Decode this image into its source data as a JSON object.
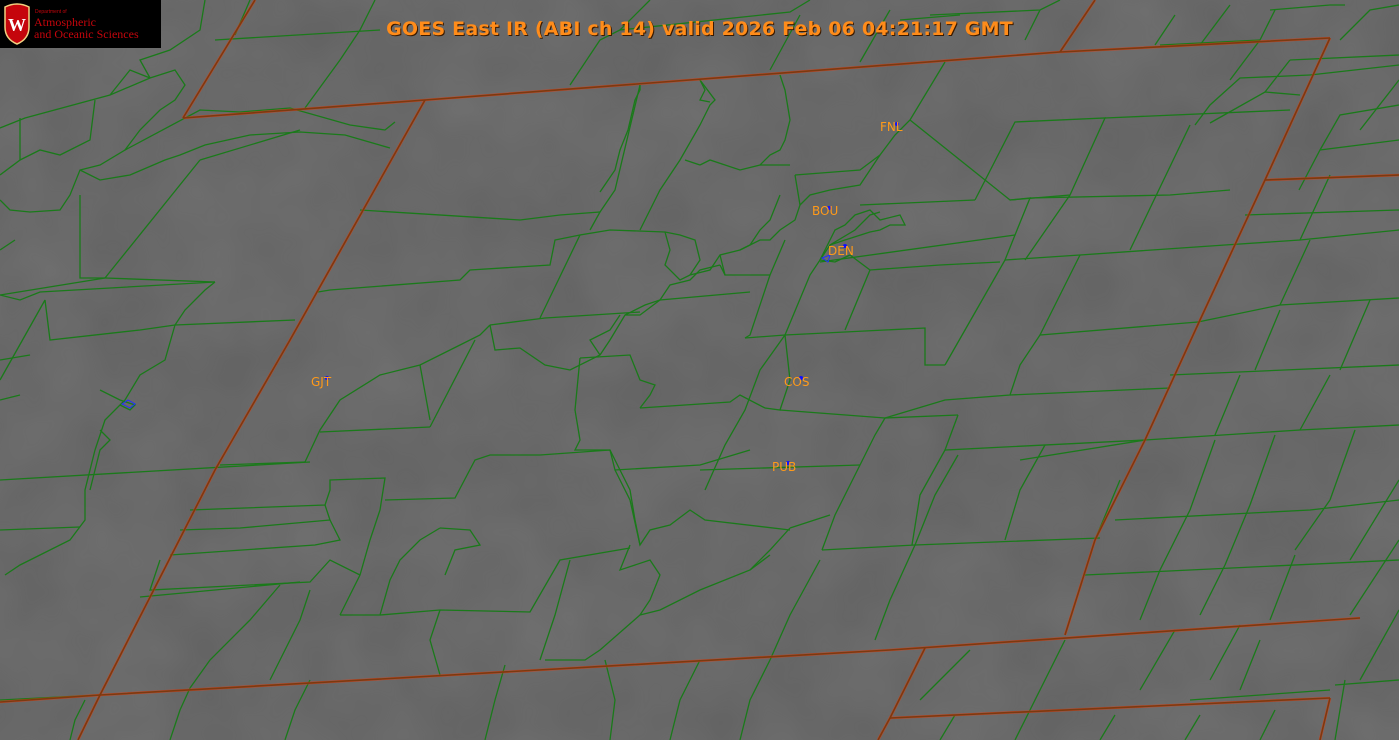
{
  "title": "GOES East IR (ABI ch 14) valid 2026 Feb 06 04:21:17 GMT",
  "logo": {
    "department": "Department of",
    "line1": "Atmospheric",
    "line2": "and Oceanic Sciences",
    "crest_letter": "W"
  },
  "colors": {
    "background_gray": "#616161",
    "county_lines": "#1a7a1a",
    "state_lines": "#7a3a10",
    "state_line_glow": "#ff3300",
    "label": "#ff9a1a",
    "station_marker": "#1010ff"
  },
  "stations": [
    {
      "id": "FNL"
    },
    {
      "id": "BOU"
    },
    {
      "id": "DEN"
    },
    {
      "id": "GJT"
    },
    {
      "id": "COS"
    },
    {
      "id": "PUB"
    }
  ]
}
